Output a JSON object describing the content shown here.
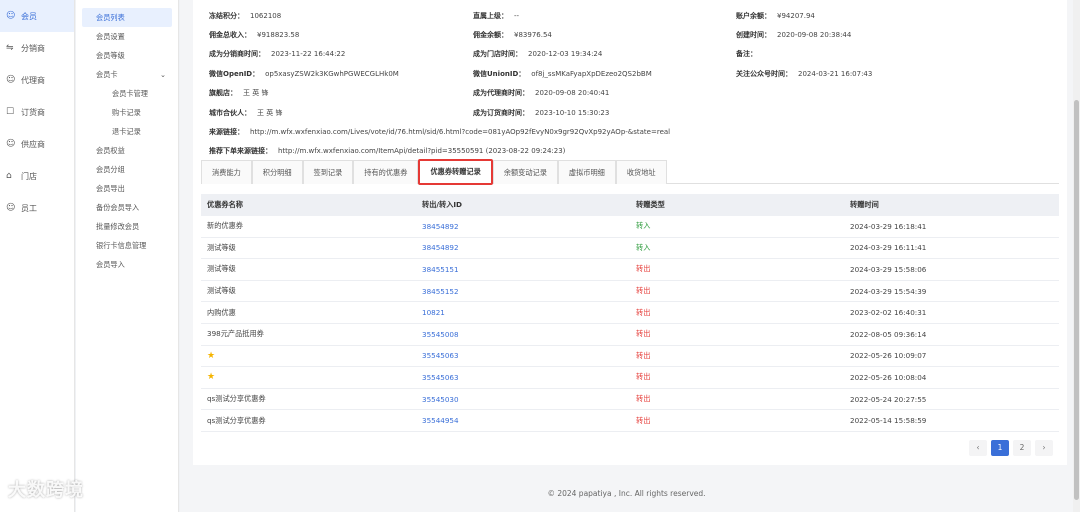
{
  "main_nav": [
    {
      "label": "会员",
      "icon": "user-icon",
      "active": true
    },
    {
      "label": "分销商",
      "icon": "share-icon",
      "active": false
    },
    {
      "label": "代理商",
      "icon": "agent-icon",
      "active": false
    },
    {
      "label": "订货商",
      "icon": "order-icon",
      "active": false
    },
    {
      "label": "供应商",
      "icon": "supplier-icon",
      "active": false
    },
    {
      "label": "门店",
      "icon": "store-icon",
      "active": false
    },
    {
      "label": "员工",
      "icon": "staff-icon",
      "active": false
    }
  ],
  "sub_nav": [
    {
      "label": "会员列表",
      "active": true
    },
    {
      "label": "会员设置"
    },
    {
      "label": "会员等级"
    },
    {
      "label": "会员卡",
      "group": true
    },
    {
      "label": "会员卡管理",
      "sub": true
    },
    {
      "label": "购卡记录",
      "sub": true
    },
    {
      "label": "退卡记录",
      "sub": true
    },
    {
      "label": "会员权益"
    },
    {
      "label": "会员分组"
    },
    {
      "label": "会员导出"
    },
    {
      "label": "备份会员导入"
    },
    {
      "label": "批量修改会员"
    },
    {
      "label": "银行卡信息管理"
    },
    {
      "label": "会员导入"
    }
  ],
  "info": {
    "frozen_points_label": "冻结积分：",
    "frozen_points": "1062108",
    "direct_superior_label": "直属上级：",
    "direct_superior": "--",
    "account_balance_label": "账户余额：",
    "account_balance": "¥94207.94",
    "commission_income_label": "佣金总收入：",
    "commission_income": "¥918823.58",
    "commission_balance_label": "佣金余额：",
    "commission_balance": "¥83976.54",
    "created_label": "创建时间：",
    "created": "2020-09-08 20:38:44",
    "distributor_time_label": "成为分销商时间：",
    "distributor_time": "2023-11-22 16:44:22",
    "store_time_label": "成为门店时间：",
    "store_time": "2020-12-03 19:34:24",
    "note_label": "备注：",
    "note": "",
    "openid_label": "微信OpenID：",
    "openid": "op5xasyZSW2k3KGwhPGWECGLHk0M",
    "unionid_label": "微信UnionID：",
    "unionid": "of8j_ssMKaFyapXpDEzeo2QS2bBM",
    "follow_time_label": "关注公众号时间：",
    "follow_time": "2024-03-21 16:07:43",
    "flagship_label": "旗舰店：",
    "flagship": "王 英 锋",
    "agent_time_label": "成为代理商时间：",
    "agent_time": "2020-09-08 20:40:41",
    "partner_label": "城市合伙人：",
    "partner": "王 英 锋",
    "ordering_time_label": "成为订货商时间：",
    "ordering_time": "2023-10-10 15:30:23",
    "source_link_label": "来源链接：",
    "source_link": "http://m.wfx.wxfenxiao.com/Lives/vote/id/76.html/sid/6.html?code=081yAOp92fEvyN0x9gr92QvXp92yAOp-&state=real",
    "recommend_link_label": "推荐下单来源链接：",
    "recommend_link": "http://m.wfx.wxfenxiao.com/ItemApi/detail?pid=35550591 (2023-08-22 09:24:23)"
  },
  "tabs": [
    {
      "label": "消费能力"
    },
    {
      "label": "积分明细"
    },
    {
      "label": "签到记录"
    },
    {
      "label": "持有的优惠券"
    },
    {
      "label": "优惠券转赠记录",
      "active": true
    },
    {
      "label": "余额变动记录"
    },
    {
      "label": "虚拟币明细"
    },
    {
      "label": "收货地址"
    }
  ],
  "table": {
    "headers": [
      "优惠券名称",
      "转出/转入ID",
      "转赠类型",
      "转赠时间"
    ],
    "rows": [
      {
        "name": "新的优惠券",
        "id": "38454892",
        "type": "转入",
        "dir": "in",
        "time": "2024-03-29 16:18:41"
      },
      {
        "name": "测试等级",
        "id": "38454892",
        "type": "转入",
        "dir": "in",
        "time": "2024-03-29 16:11:41"
      },
      {
        "name": "测试等级",
        "id": "38455151",
        "type": "转出",
        "dir": "out",
        "time": "2024-03-29 15:58:06"
      },
      {
        "name": "测试等级",
        "id": "38455152",
        "type": "转出",
        "dir": "out",
        "time": "2024-03-29 15:54:39"
      },
      {
        "name": "内购优惠",
        "id": "10821",
        "type": "转出",
        "dir": "out",
        "time": "2023-02-02 16:40:31"
      },
      {
        "name": "398元产品抵用券",
        "id": "35545008",
        "type": "转出",
        "dir": "out",
        "time": "2022-08-05 09:36:14"
      },
      {
        "name": "★",
        "star": true,
        "id": "35545063",
        "type": "转出",
        "dir": "out",
        "time": "2022-05-26 10:09:07"
      },
      {
        "name": "★",
        "star": true,
        "id": "35545063",
        "type": "转出",
        "dir": "out",
        "time": "2022-05-26 10:08:04"
      },
      {
        "name": "qs测试分享优惠券",
        "id": "35545030",
        "type": "转出",
        "dir": "out",
        "time": "2022-05-24 20:27:55"
      },
      {
        "name": "qs测试分享优惠券",
        "id": "35544954",
        "type": "转出",
        "dir": "out",
        "time": "2022-05-14 15:58:59"
      }
    ]
  },
  "pager": {
    "prev": "‹",
    "pages": [
      "1",
      "2"
    ],
    "current": "1",
    "next": "›"
  },
  "footer": "© 2024 papatiya , Inc. All rights reserved.",
  "watermark": "大数跨境"
}
